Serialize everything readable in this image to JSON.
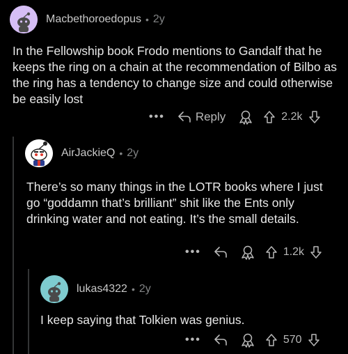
{
  "comments": [
    {
      "author": "Macbethoroedopus",
      "age": "2y",
      "body": "In the Fellowship book Frodo mentions to Gandalf that he keeps the ring on a chain at the recommendation of Bilbo as the ring has a tendency to change size and could otherwise be easily lost",
      "reply_label": "Reply",
      "score": "2.2k",
      "more": "•••"
    },
    {
      "author": "AirJackieQ",
      "age": "2y",
      "body": "There’s so many things in the LOTR books where I just go “goddamn that’s brilliant” shit like the Ents only drinking water and not eating. It’s the small details.",
      "score": "1.2k",
      "more": "•••"
    },
    {
      "author": "lukas4322",
      "age": "2y",
      "body": "I keep saying that Tolkien was genius.",
      "score": "570",
      "more": "•••"
    }
  ],
  "colors": {
    "background": "#000000",
    "text": "#e8e8e8",
    "meta": "#818384",
    "thread_line": "#343536",
    "avatar1_bg": "#d6bef5",
    "avatar3_bg": "#7ecbcf"
  }
}
